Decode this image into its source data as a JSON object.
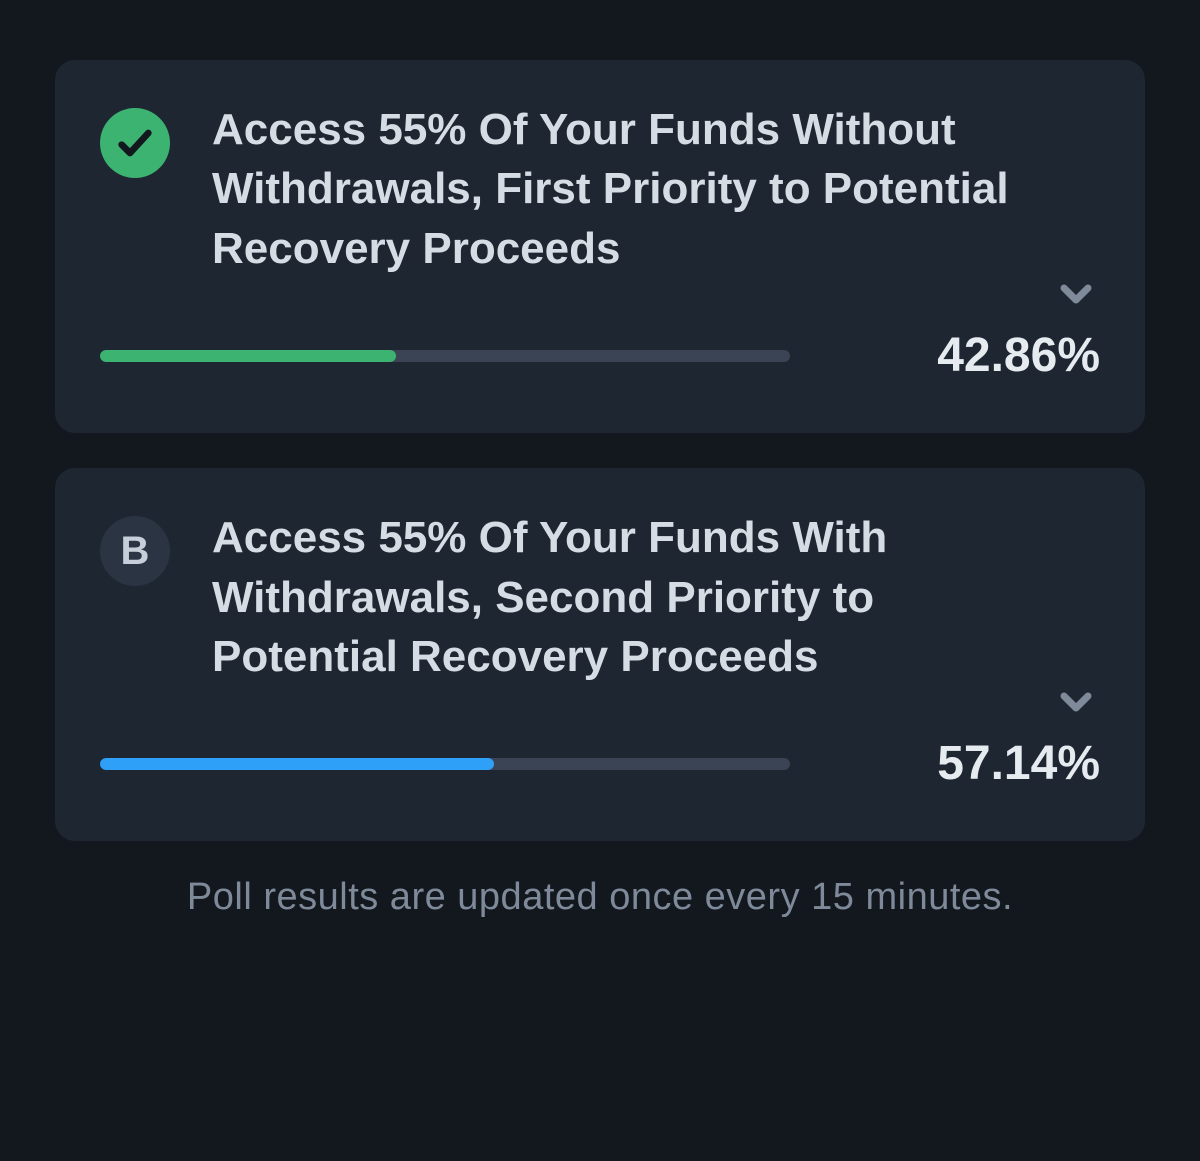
{
  "poll": {
    "options": [
      {
        "badge_type": "check",
        "badge_letter": "",
        "title": "Access 55% Of Your Funds Without Withdrawals, First Priority to Potential Recovery Proceeds",
        "percent_value": 42.86,
        "percent_label": "42.86%",
        "fill_color_class": "green"
      },
      {
        "badge_type": "letter",
        "badge_letter": "B",
        "title": "Access 55% Of Your Funds With Withdrawals, Second Priority to Potential Recovery Proceeds",
        "percent_value": 57.14,
        "percent_label": "57.14%",
        "fill_color_class": "blue"
      }
    ],
    "footer": "Poll results are updated once every 15 minutes."
  },
  "colors": {
    "background": "#13181f",
    "card": "#1e2631",
    "text_primary": "#d5dce4",
    "text_muted": "#7e8a99",
    "green": "#3cb371",
    "blue": "#2ea0f7",
    "track": "#3a4455"
  }
}
